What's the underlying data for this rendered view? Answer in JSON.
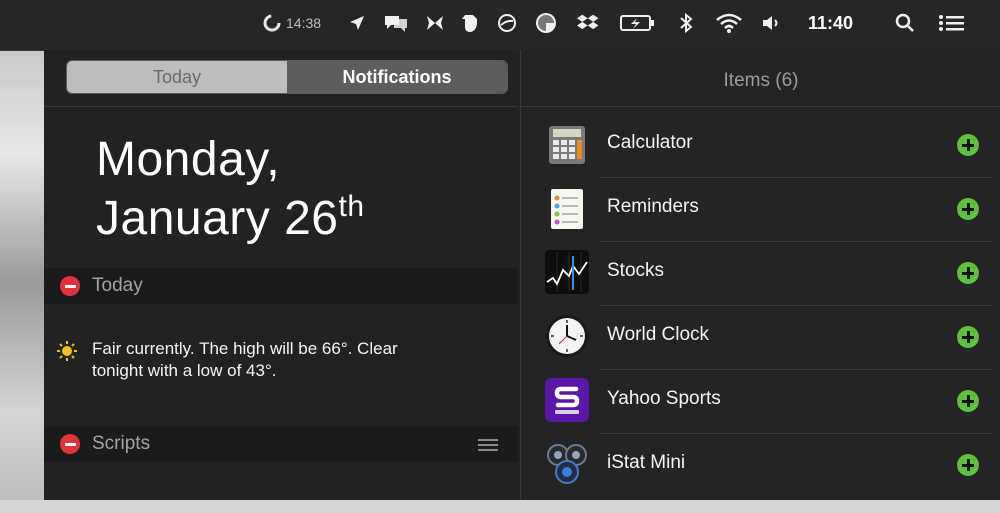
{
  "menubar": {
    "status_time": "14:38",
    "clock": "11:40",
    "icons": [
      "sync-status-icon",
      "location-arrow-icon",
      "chat-bubbles-icon",
      "butterfly-icon",
      "evernote-icon",
      "no-entry-icon",
      "pinwheel-icon",
      "dropbox-icon",
      "battery-charging-icon",
      "bluetooth-icon",
      "wifi-icon",
      "volume-icon",
      "search-icon",
      "list-icon"
    ]
  },
  "tabs": {
    "today": "Today",
    "notifications": "Notifications",
    "selected": "Today"
  },
  "date": {
    "line1": "Monday,",
    "line2": "January 26",
    "suffix": "th"
  },
  "sections": {
    "today": {
      "title": "Today"
    },
    "scripts": {
      "title": "Scripts"
    }
  },
  "weather": {
    "text": "Fair currently. The high will be 66°. Clear tonight with a low of 43°.",
    "icon": "sun-icon"
  },
  "items": {
    "title": "Items (6)",
    "list": [
      {
        "name": "Calculator",
        "icon": "calculator-icon"
      },
      {
        "name": "Reminders",
        "icon": "reminders-icon"
      },
      {
        "name": "Stocks",
        "icon": "stocks-icon"
      },
      {
        "name": "World Clock",
        "icon": "world-clock-icon"
      },
      {
        "name": "Yahoo Sports",
        "icon": "yahoo-sports-icon"
      },
      {
        "name": "iStat Mini",
        "icon": "istat-mini-icon"
      }
    ]
  },
  "colors": {
    "remove": "#e2323c",
    "add": "#5cc23b",
    "panel": "#232323",
    "yahoo_purple": "#5b18a8"
  }
}
